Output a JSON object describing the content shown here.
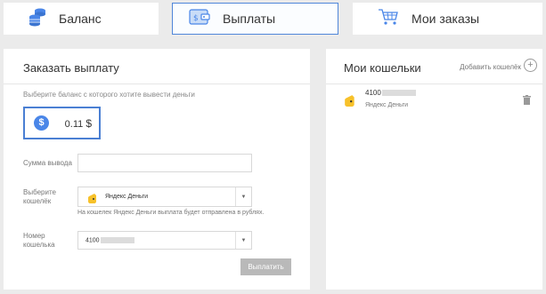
{
  "tabs": {
    "balance": {
      "label": "Баланс"
    },
    "payouts": {
      "label": "Выплаты"
    },
    "orders": {
      "label": "Мои заказы"
    }
  },
  "payout": {
    "title": "Заказать выплату",
    "hint": "Выберите баланс с которого хотите вывести деньги",
    "balance_value": "0.11",
    "balance_currency": "$",
    "amount_label": "Сумма вывода",
    "amount_value": "",
    "wallet_label_line1": "Выберите",
    "wallet_label_line2": "кошелёк",
    "wallet_selected": "Яндекс Деньги",
    "wallet_note": "На кошелек Яндекс Деньги выплата будет отправлена в рублях.",
    "number_label_line1": "Номер",
    "number_label_line2": "кошелька",
    "number_prefix": "4100",
    "submit_label": "Выплатить"
  },
  "wallets": {
    "title": "Мои кошельки",
    "add_label": "Добавить кошелёк",
    "add_icon": "+",
    "items": [
      {
        "number_prefix": "4100",
        "name": "Яндекс Деньги"
      }
    ]
  },
  "colors": {
    "accent": "#4a7fd3",
    "coin": "#4a86e8",
    "yandex": "#f7c12a",
    "button_disabled": "#b9b9b9"
  }
}
